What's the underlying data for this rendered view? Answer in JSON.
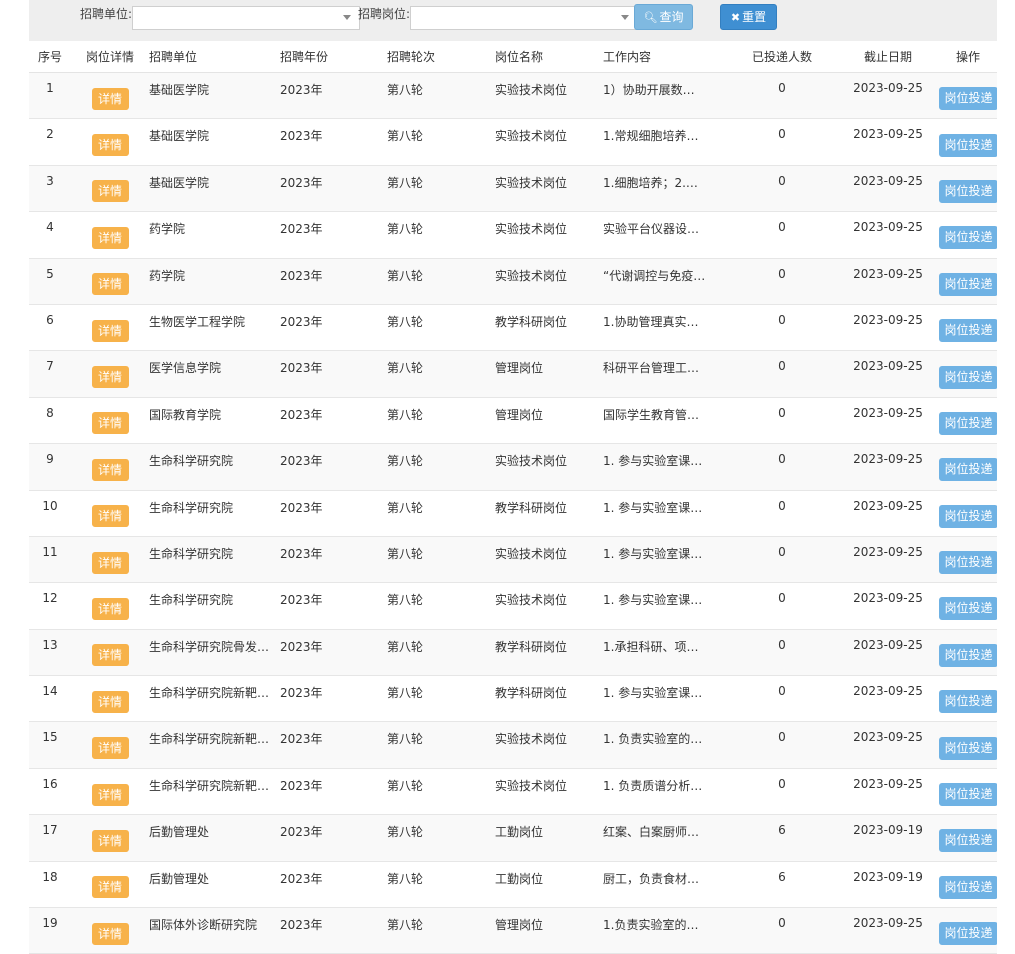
{
  "filters": {
    "unit_label": "招聘单位:",
    "unit_value": "",
    "post_label": "招聘岗位:",
    "post_value": "",
    "search_label": "查询",
    "reset_label": "重置"
  },
  "icons": {
    "search": "search-icon",
    "reset": "close-icon",
    "dropdown": "chevron-down-icon"
  },
  "colors": {
    "detail_btn": "#f7b24a",
    "apply_btn": "#6fb2e4",
    "search_btn": "#7fb9e1",
    "reset_btn": "#3f8fd2"
  },
  "table": {
    "headers": [
      "序号",
      "岗位详情",
      "招聘单位",
      "招聘年份",
      "招聘轮次",
      "岗位名称",
      "工作内容",
      "已投递人数",
      "截止日期",
      "操作"
    ],
    "detail_label": "详情",
    "apply_label": "岗位投递",
    "rows": [
      {
        "no": "1",
        "unit": "基础医学院",
        "year": "2023年",
        "round": "第八轮",
        "post": "实验技术岗位",
        "content": "1）协助开展数…",
        "count": "0",
        "deadline": "2023-09-25"
      },
      {
        "no": "2",
        "unit": "基础医学院",
        "year": "2023年",
        "round": "第八轮",
        "post": "实验技术岗位",
        "content": "1.常规细胞培养…",
        "count": "0",
        "deadline": "2023-09-25"
      },
      {
        "no": "3",
        "unit": "基础医学院",
        "year": "2023年",
        "round": "第八轮",
        "post": "实验技术岗位",
        "content": "1.细胞培养；2.…",
        "count": "0",
        "deadline": "2023-09-25"
      },
      {
        "no": "4",
        "unit": "药学院",
        "year": "2023年",
        "round": "第八轮",
        "post": "实验技术岗位",
        "content": "实验平台仪器设…",
        "count": "0",
        "deadline": "2023-09-25"
      },
      {
        "no": "5",
        "unit": "药学院",
        "year": "2023年",
        "round": "第八轮",
        "post": "实验技术岗位",
        "content": "“代谢调控与免疫…",
        "count": "0",
        "deadline": "2023-09-25"
      },
      {
        "no": "6",
        "unit": "生物医学工程学院",
        "year": "2023年",
        "round": "第八轮",
        "post": "教学科研岗位",
        "content": "1.协助管理真实…",
        "count": "0",
        "deadline": "2023-09-25"
      },
      {
        "no": "7",
        "unit": "医学信息学院",
        "year": "2023年",
        "round": "第八轮",
        "post": "管理岗位",
        "content": "科研平台管理工…",
        "count": "0",
        "deadline": "2023-09-25"
      },
      {
        "no": "8",
        "unit": "国际教育学院",
        "year": "2023年",
        "round": "第八轮",
        "post": "管理岗位",
        "content": "国际学生教育管…",
        "count": "0",
        "deadline": "2023-09-25"
      },
      {
        "no": "9",
        "unit": "生命科学研究院",
        "year": "2023年",
        "round": "第八轮",
        "post": "实验技术岗位",
        "content": "1. 参与实验室课…",
        "count": "0",
        "deadline": "2023-09-25"
      },
      {
        "no": "10",
        "unit": "生命科学研究院",
        "year": "2023年",
        "round": "第八轮",
        "post": "教学科研岗位",
        "content": "1. 参与实验室课…",
        "count": "0",
        "deadline": "2023-09-25"
      },
      {
        "no": "11",
        "unit": "生命科学研究院",
        "year": "2023年",
        "round": "第八轮",
        "post": "实验技术岗位",
        "content": "1. 参与实验室课…",
        "count": "0",
        "deadline": "2023-09-25"
      },
      {
        "no": "12",
        "unit": "生命科学研究院",
        "year": "2023年",
        "round": "第八轮",
        "post": "实验技术岗位",
        "content": "1. 参与实验室课…",
        "count": "0",
        "deadline": "2023-09-25"
      },
      {
        "no": "13",
        "unit": "生命科学研究院骨发…",
        "year": "2023年",
        "round": "第八轮",
        "post": "教学科研岗位",
        "content": "1.承担科研、项…",
        "count": "0",
        "deadline": "2023-09-25"
      },
      {
        "no": "14",
        "unit": "生命科学研究院新靶…",
        "year": "2023年",
        "round": "第八轮",
        "post": "教学科研岗位",
        "content": "1. 参与实验室课…",
        "count": "0",
        "deadline": "2023-09-25"
      },
      {
        "no": "15",
        "unit": "生命科学研究院新靶…",
        "year": "2023年",
        "round": "第八轮",
        "post": "实验技术岗位",
        "content": "1. 负责实验室的…",
        "count": "0",
        "deadline": "2023-09-25"
      },
      {
        "no": "16",
        "unit": "生命科学研究院新靶…",
        "year": "2023年",
        "round": "第八轮",
        "post": "实验技术岗位",
        "content": "1. 负责质谱分析…",
        "count": "0",
        "deadline": "2023-09-25"
      },
      {
        "no": "17",
        "unit": "后勤管理处",
        "year": "2023年",
        "round": "第八轮",
        "post": "工勤岗位",
        "content": "红案、白案厨师…",
        "count": "6",
        "deadline": "2023-09-19"
      },
      {
        "no": "18",
        "unit": "后勤管理处",
        "year": "2023年",
        "round": "第八轮",
        "post": "工勤岗位",
        "content": "厨工，负责食材…",
        "count": "6",
        "deadline": "2023-09-19"
      },
      {
        "no": "19",
        "unit": "国际体外诊断研究院",
        "year": "2023年",
        "round": "第八轮",
        "post": "管理岗位",
        "content": "1.负责实验室的…",
        "count": "0",
        "deadline": "2023-09-25"
      }
    ]
  }
}
